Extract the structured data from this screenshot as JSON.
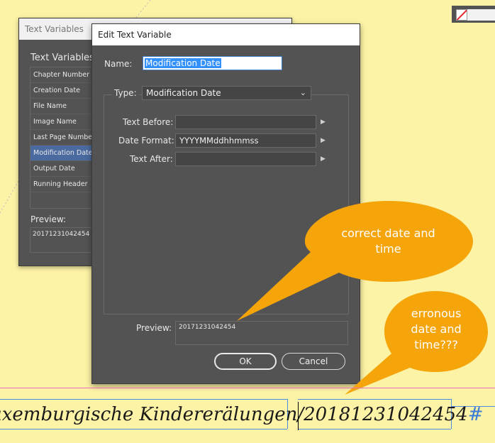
{
  "text_variables_dialog": {
    "title": "Text Variables",
    "heading": "Text Variables:",
    "items": [
      {
        "label": "Chapter Number",
        "selected": false
      },
      {
        "label": "Creation Date",
        "selected": false
      },
      {
        "label": "File Name",
        "selected": false
      },
      {
        "label": "Image Name",
        "selected": false
      },
      {
        "label": "Last Page Number",
        "selected": false
      },
      {
        "label": "Modification Date",
        "selected": true
      },
      {
        "label": "Output Date",
        "selected": false
      },
      {
        "label": "Running Header",
        "selected": false
      }
    ],
    "preview_label": "Preview:",
    "preview_value": "20171231042454"
  },
  "edit_dialog": {
    "title": "Edit Text Variable",
    "name_label": "Name:",
    "name_value": "Modification Date",
    "type_label": "Type:",
    "type_value": "Modification Date",
    "text_before_label": "Text Before:",
    "text_before_value": "",
    "date_format_label": "Date Format:",
    "date_format_value": "YYYYMMddhhmmss",
    "text_after_label": "Text After:",
    "text_after_value": "",
    "preview_label": "Preview:",
    "preview_value": "20171231042454",
    "ok_label": "OK",
    "cancel_label": "Cancel"
  },
  "annotations": {
    "bubble1": {
      "line1": "correct date and",
      "line2": "time",
      "color": "#f5a40a"
    },
    "bubble2": {
      "line1": "erronous",
      "line2": "date and",
      "line3": "time???",
      "color": "#f5a40a"
    }
  },
  "document": {
    "text_left": "uxemburgische Kindererälungen",
    "separator": "/",
    "text_right": "20181231042454",
    "end_mark": "#"
  },
  "colors": {
    "page_background": "#fdf3a6",
    "dialog_background": "#535353",
    "selection": "#4a6aa0",
    "accent_orange": "#f5a40a"
  }
}
